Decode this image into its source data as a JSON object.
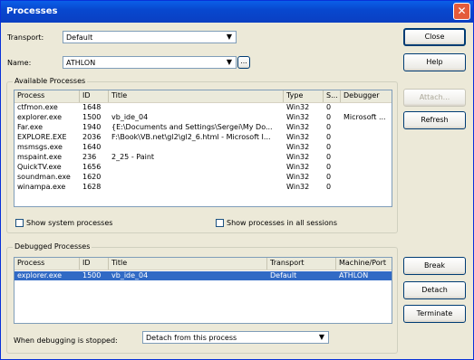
{
  "window": {
    "title": "Processes",
    "close_glyph": "✕"
  },
  "transport": {
    "label": "Transport:",
    "value": "Default"
  },
  "name": {
    "label": "Name:",
    "value": "ATHLON",
    "browse_label": "..."
  },
  "buttons": {
    "close": "Close",
    "help": "Help",
    "attach": "Attach...",
    "refresh": "Refresh",
    "break": "Break",
    "detach": "Detach",
    "terminate": "Terminate"
  },
  "available": {
    "group_label": "Available Processes",
    "columns": [
      "Process",
      "ID",
      "Title",
      "Type",
      "S...",
      "Debugger"
    ],
    "rows": [
      {
        "process": "ctfmon.exe",
        "id": "1648",
        "title": "",
        "type": "Win32",
        "s": "0",
        "debugger": ""
      },
      {
        "process": "explorer.exe",
        "id": "1500",
        "title": "vb_ide_04",
        "type": "Win32",
        "s": "0",
        "debugger": "Microsoft ..."
      },
      {
        "process": "Far.exe",
        "id": "1940",
        "title": "{E:\\Documents and Settings\\Sergei\\My Do...",
        "type": "Win32",
        "s": "0",
        "debugger": ""
      },
      {
        "process": "EXPLORE.EXE",
        "id": "2036",
        "title": "F:\\Book\\VB.net\\gl2\\gl2_6.html - Microsoft I...",
        "type": "Win32",
        "s": "0",
        "debugger": ""
      },
      {
        "process": "msmsgs.exe",
        "id": "1640",
        "title": "",
        "type": "Win32",
        "s": "0",
        "debugger": ""
      },
      {
        "process": "mspaint.exe",
        "id": "236",
        "title": "2_25 - Paint",
        "type": "Win32",
        "s": "0",
        "debugger": ""
      },
      {
        "process": "QuickTV.exe",
        "id": "1656",
        "title": "",
        "type": "Win32",
        "s": "0",
        "debugger": ""
      },
      {
        "process": "soundman.exe",
        "id": "1620",
        "title": "",
        "type": "Win32",
        "s": "0",
        "debugger": ""
      },
      {
        "process": "winampa.exe",
        "id": "1628",
        "title": "",
        "type": "Win32",
        "s": "0",
        "debugger": ""
      }
    ],
    "show_system_label": "Show system processes",
    "show_all_sessions_label": "Show processes in all sessions"
  },
  "debugged": {
    "group_label": "Debugged Processes",
    "columns": [
      "Process",
      "ID",
      "Title",
      "Transport",
      "Machine/Port"
    ],
    "rows": [
      {
        "process": "explorer.exe",
        "id": "1500",
        "title": "vb_ide_04",
        "transport": "Default",
        "machine": "ATHLON"
      }
    ]
  },
  "when_stopped": {
    "label": "When debugging is stopped:",
    "value": "Detach from this process"
  },
  "colors": {
    "title_bar": "#0A5FE8",
    "selection": "#316AC5",
    "dialog_bg": "#ECE9D8"
  }
}
